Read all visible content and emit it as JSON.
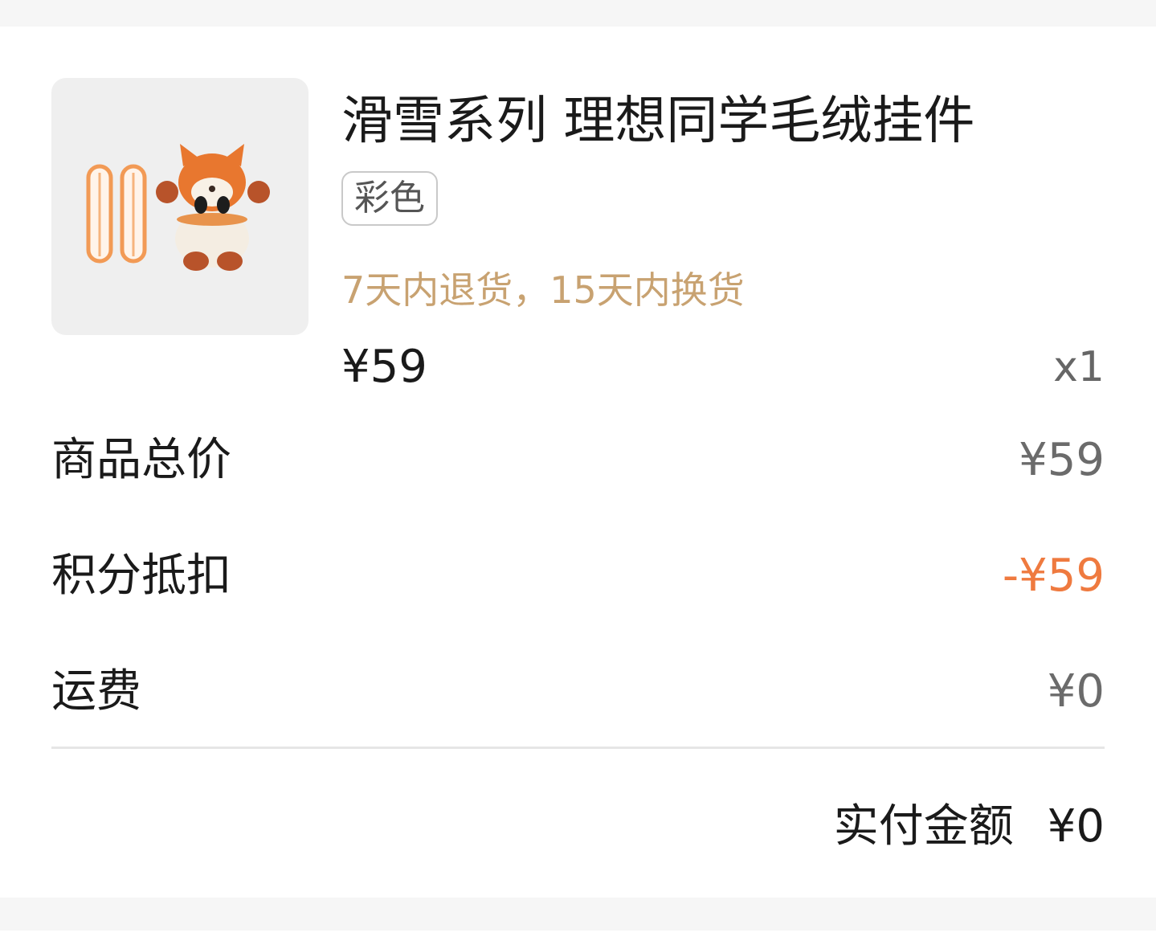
{
  "product": {
    "title": "滑雪系列 理想同学毛绒挂件",
    "variant_tag": "彩色",
    "policy": "7天内退货，15天内换货",
    "unit_price": "¥59",
    "quantity": "x1",
    "image_icon": "plush-fox-mascot-with-skis"
  },
  "summary": {
    "rows": [
      {
        "label": "商品总价",
        "value": "¥59"
      },
      {
        "label": "积分抵扣",
        "value": "-¥59"
      },
      {
        "label": "运费",
        "value": "¥0"
      }
    ],
    "total_label": "实付金额",
    "total_value": "¥0"
  },
  "colors": {
    "policy": "#c8a271",
    "discount": "#ef7a3f"
  }
}
